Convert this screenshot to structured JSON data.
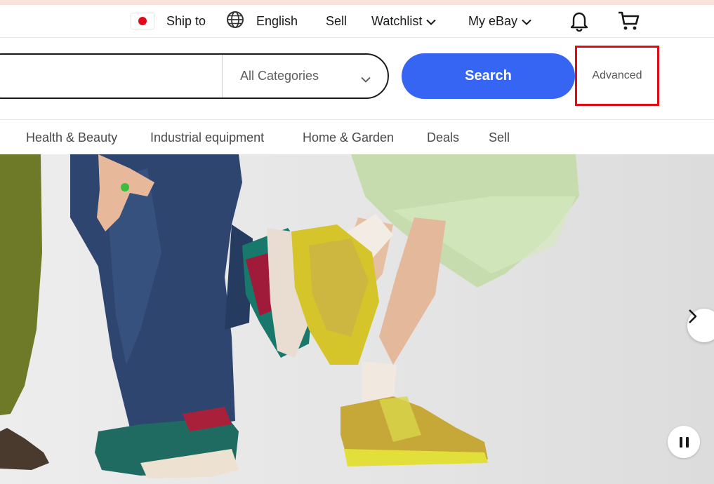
{
  "header": {
    "ship_to_label": "Ship to",
    "language_label": "English",
    "sell_label": "Sell",
    "watchlist_label": "Watchlist",
    "my_ebay_label": "My eBay",
    "flag_color": "#e3091b"
  },
  "search": {
    "query_value": "",
    "category_selected": "All Categories",
    "button_label": "Search",
    "advanced_label": "Advanced",
    "accent_color": "#3665f3",
    "highlight_color": "#e00b15"
  },
  "categories": [
    {
      "label": "Health & Beauty"
    },
    {
      "label": "Industrial equipment"
    },
    {
      "label": "Home & Garden"
    },
    {
      "label": "Deals"
    },
    {
      "label": "Sell"
    }
  ],
  "icons": {
    "globe": "globe-icon",
    "bell": "bell-icon",
    "cart": "cart-icon",
    "chevron": "chevron-down-icon",
    "next": "chevron-right-icon",
    "pause": "pause-icon"
  }
}
